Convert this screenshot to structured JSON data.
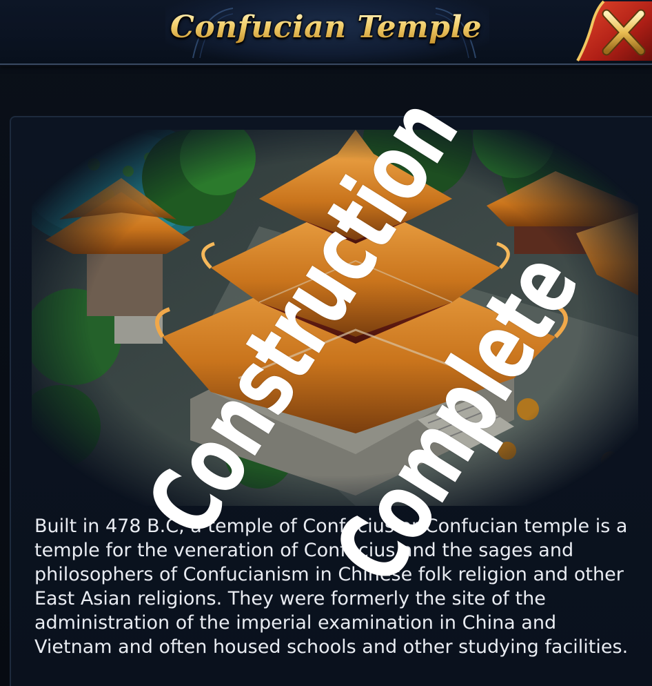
{
  "header": {
    "title": "Confucian Temple",
    "close_icon": "close-x-icon"
  },
  "illustration": {
    "subject": "confucian-temple-building"
  },
  "description": "Built in 478 B.C, a temple of Confucius or Confucian temple is a temple for the veneration of Confucius and the sages and philosophers of Confucianism in Chinese folk religion and other East Asian religions. They were formerly the site of the administration of the imperial examination in China and Vietnam and often housed schools and other studying facilities.",
  "stamp": {
    "line1": "Construction",
    "line2": "Complete"
  },
  "colors": {
    "title_gold": "#f2cf6c",
    "close_gold": "#e6b84a",
    "close_red": "#c4281c",
    "roof_orange": "#d8882a",
    "panel_bg": "#0a111d"
  }
}
